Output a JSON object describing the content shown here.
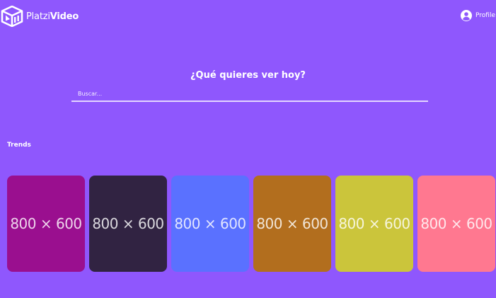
{
  "header": {
    "logo": {
      "text_light": "Platzi",
      "text_bold": "Video"
    },
    "profile": {
      "label": "Profile"
    }
  },
  "search": {
    "title": "¿Qué quieres ver hoy?",
    "placeholder": "Buscar...",
    "value": ""
  },
  "trends": {
    "title": "Trends",
    "items": [
      {
        "label": "800 × 600",
        "color": "#9a0f8f"
      },
      {
        "label": "800 × 600",
        "color": "#312342"
      },
      {
        "label": "800 × 600",
        "color": "#5a71ff"
      },
      {
        "label": "800 × 600",
        "color": "#b26e1e"
      },
      {
        "label": "800 × 600",
        "color": "#cbc53b"
      },
      {
        "label": "800 × 600",
        "color": "#ff7890"
      }
    ]
  },
  "colors": {
    "background": "#8f57fd",
    "text": "#ffffff"
  }
}
